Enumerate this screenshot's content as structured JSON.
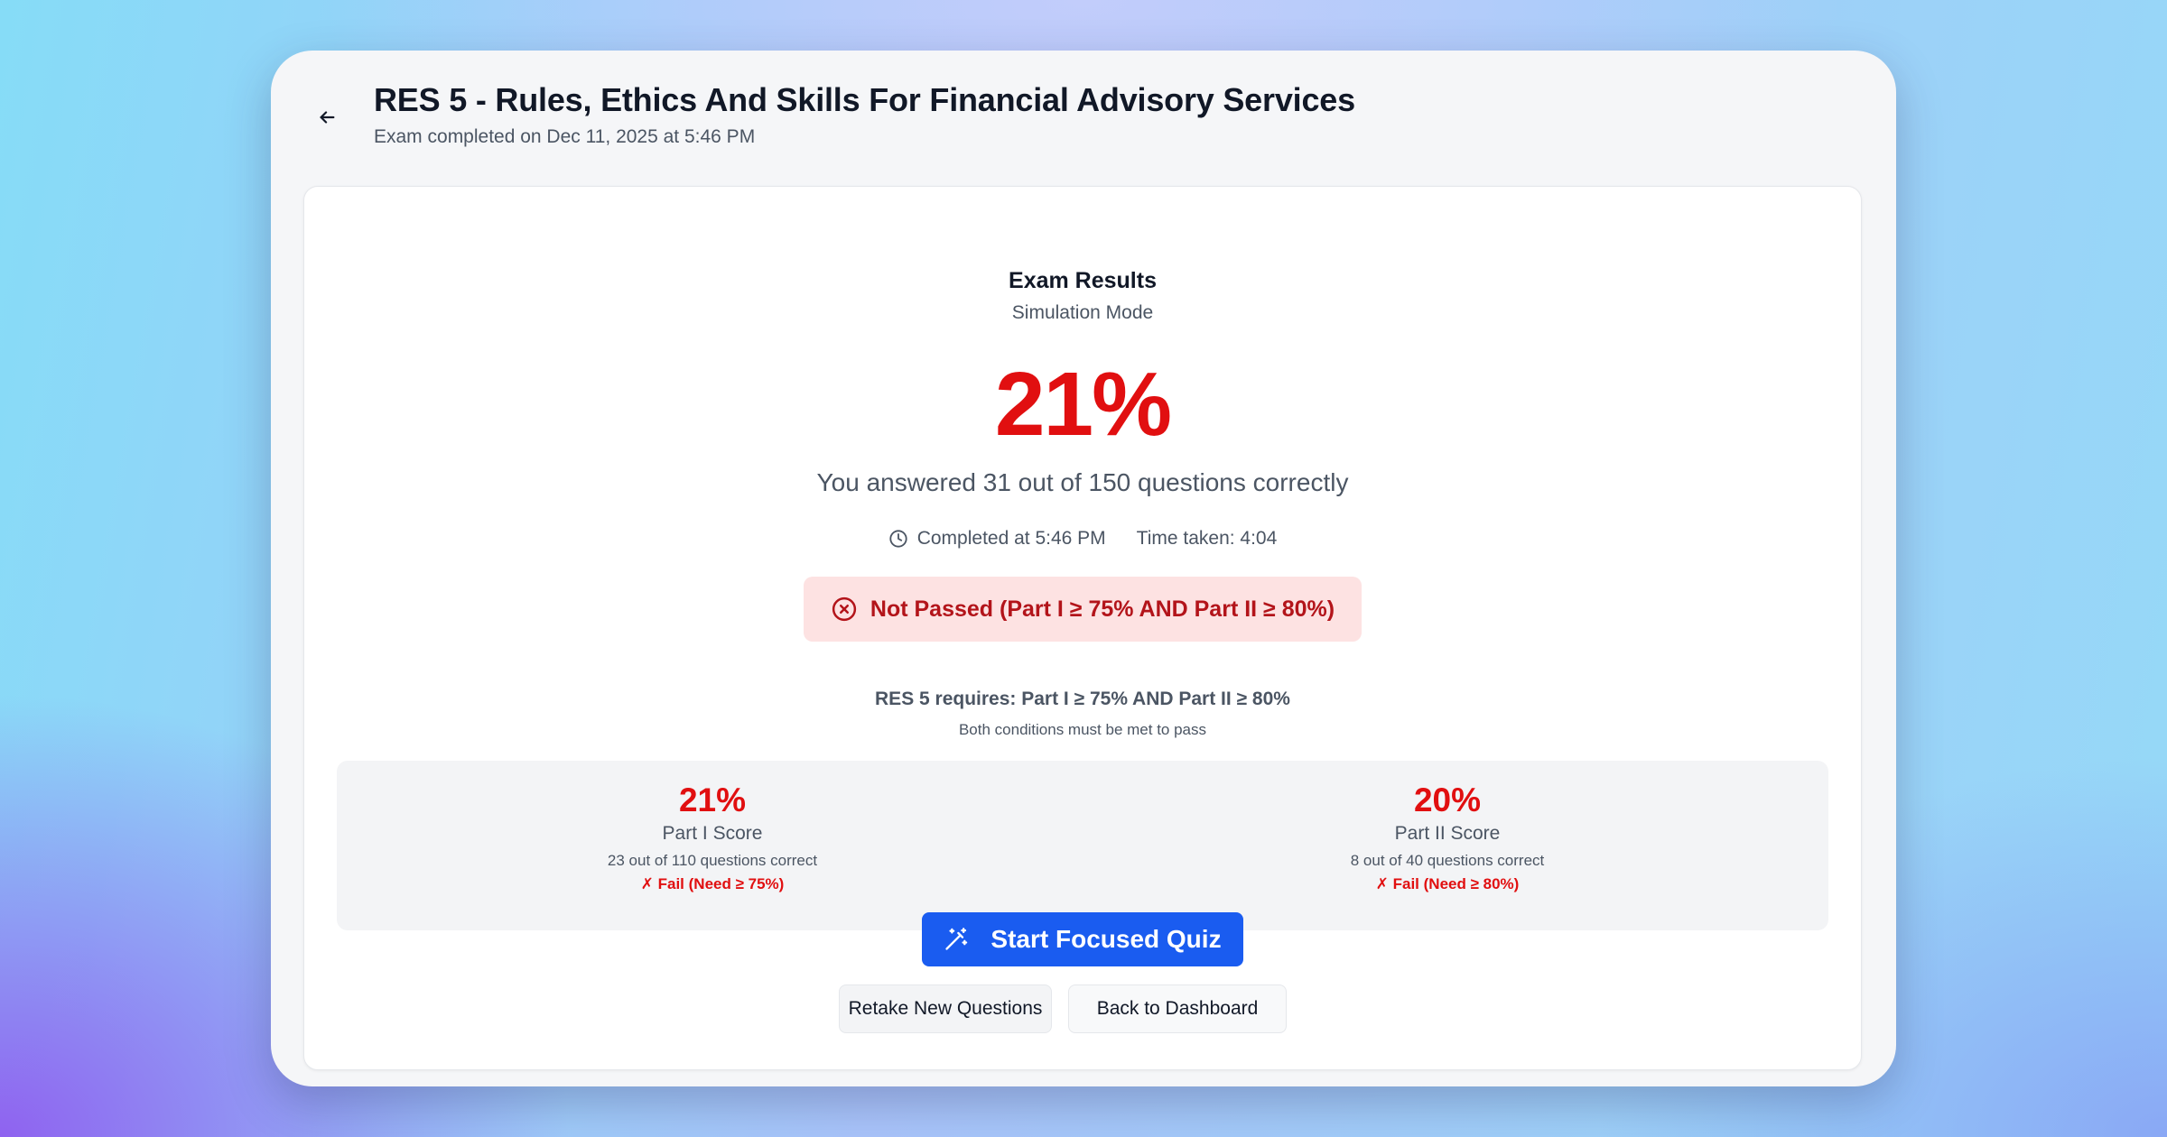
{
  "header": {
    "title": "RES 5 - Rules, Ethics And Skills For Financial Advisory Services",
    "subtitle": "Exam completed on Dec 11, 2025 at 5:46 PM",
    "back_icon": "arrow-left-icon"
  },
  "results": {
    "title": "Exam Results",
    "mode": "Simulation Mode",
    "score": "21%",
    "answered": "You answered 31 out of 150 questions correctly",
    "completed_at": "Completed at 5:46 PM",
    "time_taken": "Time taken: 4:04",
    "clock_icon": "clock-icon",
    "status": "Not Passed (Part I ≥ 75% AND Part II ≥ 80%)",
    "status_icon": "x-circle-icon",
    "requires": "RES 5 requires: Part I ≥ 75% AND Part II ≥ 80%",
    "requires_note": "Both conditions must be met to pass"
  },
  "parts": [
    {
      "score": "21%",
      "label": "Part I Score",
      "detail": "23 out of 110 questions correct",
      "result": "✗ Fail (Need ≥ 75%)"
    },
    {
      "score": "20%",
      "label": "Part II Score",
      "detail": "8 out of 40 questions correct",
      "result": "✗ Fail (Need ≥ 80%)"
    }
  ],
  "actions": {
    "focused_quiz": "Start Focused Quiz",
    "focused_quiz_icon": "magic-wand-icon",
    "retake": "Retake New Questions",
    "dashboard": "Back to Dashboard"
  },
  "colors": {
    "fail_red": "#e10f10",
    "status_bg": "#fde2e2",
    "status_text": "#b3141a",
    "primary": "#1a5cf0"
  }
}
